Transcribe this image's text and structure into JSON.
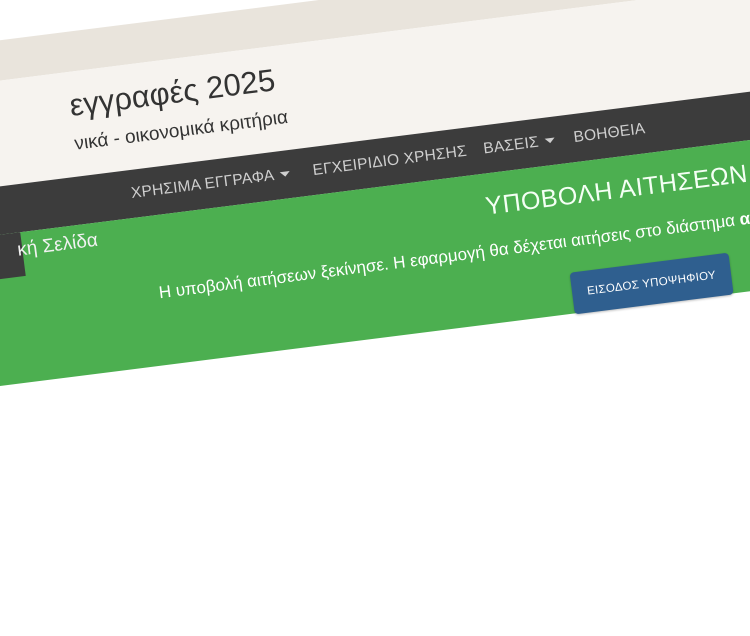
{
  "header": {
    "title": "εγγραφές 2025",
    "subtitle": "νικά - οικονομικά κριτήρια"
  },
  "nav": {
    "items": [
      {
        "label": "ΧΡΗΣΙΜΑ ΕΓΓΡΑΦΑ",
        "dropdown": true
      },
      {
        "label": "ΕΓΧΕΙΡΙΔΙΟ ΧΡΗΣΗΣ",
        "dropdown": false
      },
      {
        "label": "ΒΑΣΕΙΣ",
        "dropdown": true
      },
      {
        "label": "ΒΟΗΘΕΙΑ",
        "dropdown": false
      }
    ],
    "home_label": "κή Σελίδα"
  },
  "banner": {
    "title": "ΥΠΟΒΟΛΗ ΑΙΤΗΣΕΩΝ",
    "text": "Η υποβολή αιτήσεων ξεκίνησε. Η εφαρμογή θα δέχεται αιτήσεις στο διάστημα",
    "text_bold": "από",
    "button_label": "ΕΙΣΟΔΟΣ ΥΠΟΨΗΦΙΟΥ"
  },
  "colors": {
    "header_bg": "#f6f3ef",
    "navbar_bg": "#3c3c3c",
    "banner_bg": "#4caf50",
    "button_bg": "#2f5f8f"
  }
}
